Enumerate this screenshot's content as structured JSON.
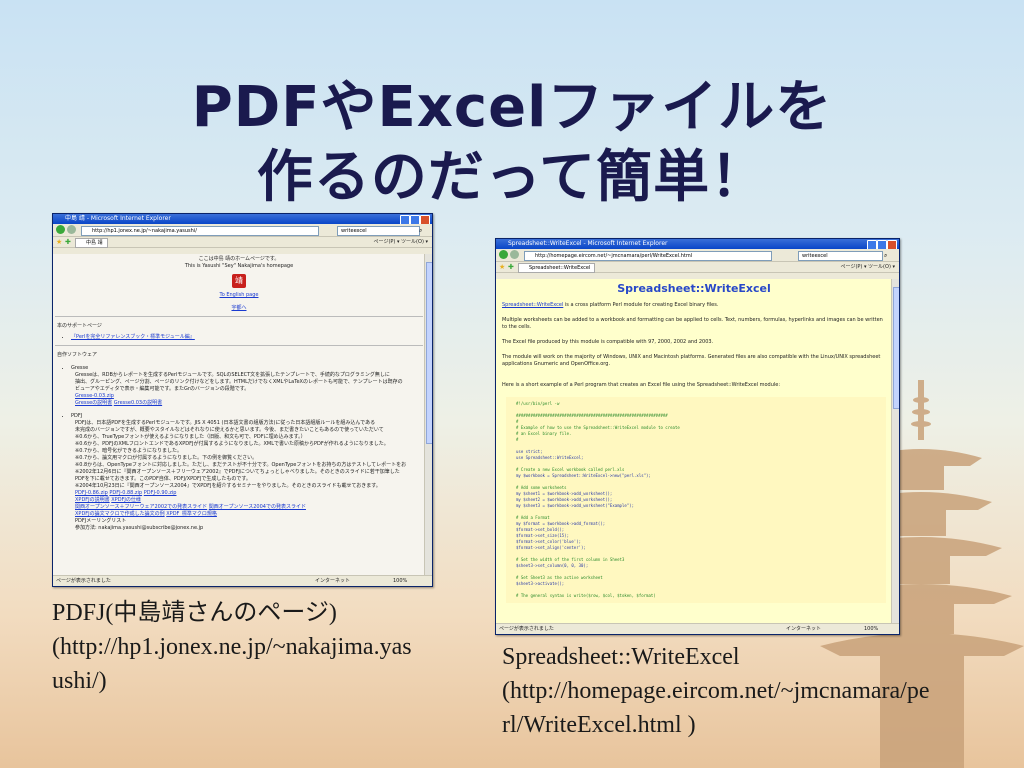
{
  "slide": {
    "title_line1": "PDFやExcelファイルを",
    "title_line2": "作るのだって簡単！"
  },
  "browser1": {
    "window_title": "中島 靖 - Microsoft Internet Explorer",
    "address": "http://hp1.jonex.ne.jp/~nakajima.yasushi/",
    "search": "writeexcel",
    "tab_label": "中島 靖",
    "toolbar_right": "ページ(P) ▾  ツール(O) ▾",
    "status_left": "ページが表示されました",
    "status_zone": "インターネット",
    "status_zoom": "100%",
    "content": {
      "intro1": "ここは中島 靖のホームページです。",
      "intro2": "This is Yasushi \"Sey\" Nakajima's homepage",
      "seal_char": "靖",
      "english_link": "To English page",
      "dialog_link": "宇都へ",
      "support_heading": "本のサポートページ",
      "support_item": "『Perlを完全リファレンスブック・標準モジュール編』",
      "software_heading": "自作ソフトウェア",
      "gresse_name": "Gresse",
      "gresse_desc1": "Gresseは、RDBからレポートを生成するPerlモジュールです。SQLのSELECT文を拡張したテンプレートで、手続的なプログラミング無しに",
      "gresse_desc2": "抽出、グルーピング、ページ分割、ページのリンク付けなどをします。HTMLだけでなくXMLやLaTeXのレポートも可能で、テンプレートは既存の",
      "gresse_desc3": "ビューアやエディタで表示・編集可能です。またGrのバージョンの段階です。",
      "gresse_link1": "Gresse-0.03.zip",
      "gresse_link2": "Gresseの説明書",
      "gresse_link3": "Gresse0.03の説明書",
      "pdfj_name": "PDFJ",
      "pdfj_desc1": "PDFJは、日本語PDFを生成するPerlモジュールです。JIS X 4051 (日本語文書の組版方法)に従った日本語組版ルールを組み込んである",
      "pdfj_desc2": "未完成のバージョンですが、概要やスタイルなどはそれなりに使えるかと思います。今後、まだ書きたいこともあるので使っていただいて",
      "pdfj_desc3": "※0.6から、TrueTypeフォントが使えるようになりました（旧版、和文も可で、PDFに埋め込みます。）",
      "pdfj_desc4": "※0.6から、PDFJのXMLフロントエンドであるXPDFJが付属するようになりました。XMLで書いた原稿からPDFが作れるようになりました。",
      "pdfj_desc5": "※0.7から、暗号化ができるようになりました。",
      "pdfj_desc6": "※0.7から、論文用マクロが付属するようになりました。下の例を御覧ください。",
      "pdfj_desc7": "※0.8からは、OpenTypeフォントに対応しました。ただし、まだテストが不十分です。OpenTypeフォントをお持ちの方はテストしてレポートをお",
      "pdfj_desc8": "※2002年12月6日に『関西オープンソース＋フリーウェア2002』でPDFJについてちょっとしゃべりました。そのときのスライドに若干加筆した",
      "pdfj_desc9": "PDFを下に載せておきます。このPDF自体、PDFJ/XPDFJで生成したものです。",
      "pdfj_desc10": "※2004年10月23日に『関西オープンソース2004』でXPDFJを紹介するセミナーをやりました。そのときのスライドも載せておきます。",
      "pdfj_link1": "PDFJ-0.86.zip",
      "pdfj_link2": "PDFJ-0.88.zip",
      "pdfj_link3": "PDFJ-0.90.zip",
      "pdfj_link4": "XPDFJの説明書",
      "pdfj_link5": "XPDFJの仕様",
      "pdfj_link6": "関西オープンソース＋フリーウェア2002での発表スライド",
      "pdfj_link7": "関西オープンソース2004での発表スライド",
      "pdfj_link8": "XPDFJの論文マクロで作成した論文の例",
      "pdfj_link9": "XPDF_標準マクロ規格",
      "pdfj_ml": "PDFJメーリングリスト",
      "pdfj_ml2": "参加方法: nakajima.yasushi@subscribe@jonex.ne.jp"
    }
  },
  "browser2": {
    "window_title": "Spreadsheet::WriteExcel - Microsoft Internet Explorer",
    "address": "http://homepage.eircom.net/~jmcnamara/perl/WriteExcel.html",
    "search": "writeexcel",
    "tab_label": "Spreadsheet::WriteExcel",
    "toolbar_right": "ページ(P) ▾  ツール(O) ▾",
    "status_left": "ページが表示されました",
    "status_zone": "インターネット",
    "status_zoom": "100%",
    "content": {
      "heading": "Spreadsheet::WriteExcel",
      "p1_link": "Spreadsheet::WriteExcel",
      "p1_rest": " is a cross platform Perl module for creating Excel binary files.",
      "p2": "Multiple worksheets can be added to a workbook and formatting can be applied to cells. Text, numbers, formulas, hyperlinks and images can be written to the cells.",
      "p3": "The Excel file produced by this module is compatible with 97, 2000, 2002 and 2003.",
      "p4": "The module will work on the majority of Windows, UNIX and Macintosh platforms. Generated files are also compatible with the Linux/UNIX spreadsheet applications Gnumeric and OpenOffice.org.",
      "p5": "Here is a short example of a Perl program that creates an Excel file using the Spreadsheet::WriteExcel module:",
      "code": [
        {
          "t": "#!/usr/bin/perl -w",
          "c": "cm"
        },
        {
          "t": "",
          "c": ""
        },
        {
          "t": "###############################################################",
          "c": "cm"
        },
        {
          "t": "#",
          "c": "cm"
        },
        {
          "t": "# Example of how to use the Spreadsheet::WriteExcel module to create",
          "c": "cm"
        },
        {
          "t": "# an Excel binary file.",
          "c": "cm"
        },
        {
          "t": "#",
          "c": "cm"
        },
        {
          "t": "",
          "c": ""
        },
        {
          "t": "use strict;",
          "c": ""
        },
        {
          "t": "use Spreadsheet::WriteExcel;",
          "c": ""
        },
        {
          "t": "",
          "c": ""
        },
        {
          "t": "# Create a new Excel workbook called perl.xls",
          "c": "cm"
        },
        {
          "t": "my $workbook = Spreadsheet::WriteExcel->new(\"perl.xls\");",
          "c": ""
        },
        {
          "t": "",
          "c": ""
        },
        {
          "t": "# Add some worksheets",
          "c": "cm"
        },
        {
          "t": "my $sheet1 = $workbook->add_worksheet();",
          "c": ""
        },
        {
          "t": "my $sheet2 = $workbook->add_worksheet();",
          "c": ""
        },
        {
          "t": "my $sheet3 = $workbook->add_worksheet(\"Example\");",
          "c": ""
        },
        {
          "t": "",
          "c": ""
        },
        {
          "t": "# Add a Format",
          "c": "cm"
        },
        {
          "t": "my $format = $workbook->add_format();",
          "c": ""
        },
        {
          "t": "$format->set_bold();",
          "c": ""
        },
        {
          "t": "$format->set_size(15);",
          "c": ""
        },
        {
          "t": "$format->set_color('blue');",
          "c": ""
        },
        {
          "t": "$format->set_align('center');",
          "c": ""
        },
        {
          "t": "",
          "c": ""
        },
        {
          "t": "# Set the width of the first column in Sheet3",
          "c": "cm"
        },
        {
          "t": "$sheet3->set_column(0, 0, 30);",
          "c": ""
        },
        {
          "t": "",
          "c": ""
        },
        {
          "t": "# Set Sheet3 as the active worksheet",
          "c": "cm"
        },
        {
          "t": "$sheet3->activate();",
          "c": ""
        },
        {
          "t": "",
          "c": ""
        },
        {
          "t": "# The general syntax is write($row, $col, $token, $format)",
          "c": "cm"
        }
      ]
    }
  },
  "captions": {
    "left_line1": "PDFJ(中島靖さんのページ)",
    "left_line2": "(http://hp1.jonex.ne.jp/~nakajima.yas",
    "left_line3": "ushi/)",
    "right_line1": "Spreadsheet::WriteExcel",
    "right_line2": "(http://homepage.eircom.net/~jmcnamara/pe",
    "right_line3": "rl/WriteExcel.html )"
  }
}
